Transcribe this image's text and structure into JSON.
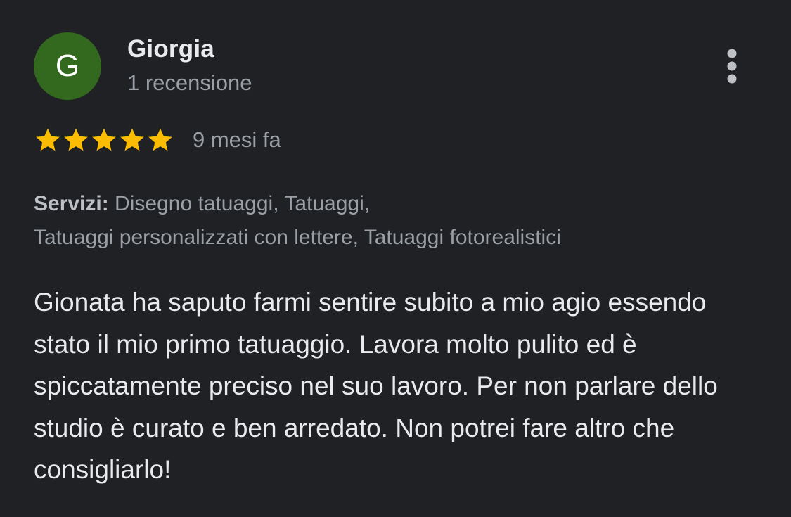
{
  "reviewer": {
    "initial": "G",
    "avatar_color": "#33691e",
    "name": "Giorgia",
    "review_count": "1 recensione"
  },
  "menu": {
    "icon": "more-vert-icon"
  },
  "rating": {
    "stars": 5,
    "max_stars": 5,
    "star_color": "#fbbc04",
    "date": "9 mesi fa"
  },
  "services": {
    "label": "Servizi:",
    "line1": " Disegno tatuaggi, Tatuaggi,",
    "line2": "Tatuaggi personalizzati con lettere, Tatuaggi fotorealistici"
  },
  "review": {
    "text": "Gionata ha saputo farmi sentire subito a mio agio essendo stato il mio primo tatuaggio. Lavora molto pulito ed è spiccatamente preciso nel suo lavoro. Per non parlare dello studio è curato e ben arredato. Non potrei fare altro che consigliarlo!"
  },
  "theme": {
    "background": "#202124",
    "primary_text": "#e8eaed",
    "secondary_text": "#9aa0a6"
  }
}
